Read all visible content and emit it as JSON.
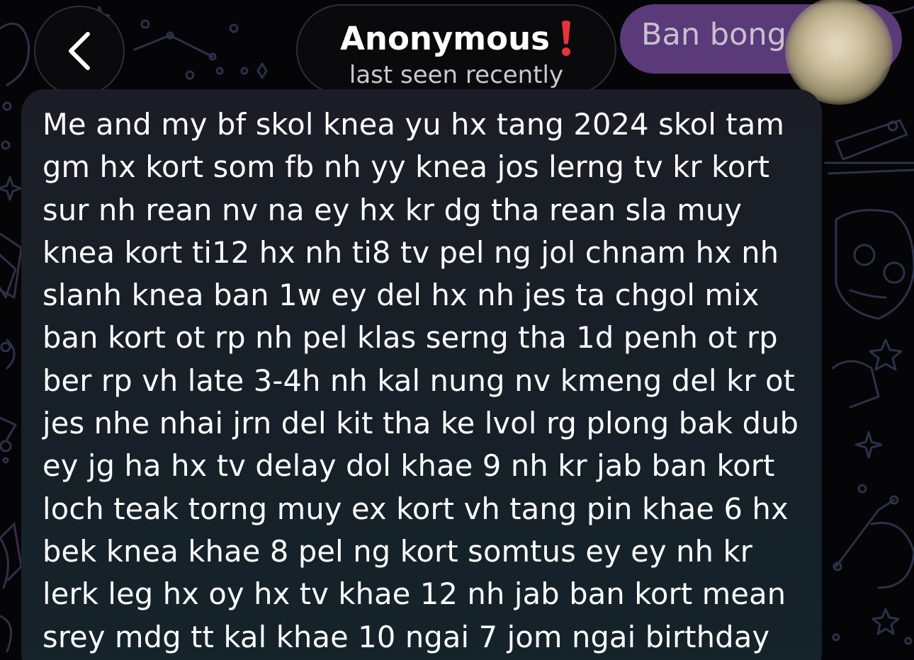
{
  "header": {
    "contact_name": "Anonymous",
    "status": "last seen recently",
    "chat_pill_label": "Ban bong"
  },
  "icons": {
    "back": "chevron-left-icon",
    "warning": "exclamation-icon",
    "avatar": "blurred-profile-photo"
  },
  "colors": {
    "warning": "#e8333a",
    "chat_pill": "#5a3a78",
    "bubble": "#1a1f28"
  },
  "message": {
    "text": "Me and my bf skol knea yu hx tang 2024 skol tam gm hx kort som fb nh yy knea jos lerng tv kr kort sur nh rean nv na ey hx kr dg tha rean sla muy knea kort ti12 hx nh ti8 tv pel ng jol chnam hx nh slanh knea ban 1w ey del hx nh jes ta chgol mix ban kort ot rp nh pel klas serng tha 1d penh ot rp ber rp vh late 3-4h nh kal nung nv kmeng del kr ot jes nhe nhai jrn del kit tha ke lvol rg plong bak dub ey jg ha hx tv delay dol khae 9 nh kr jab ban kort loch teak torng muy ex kort vh tang pin khae 6 hx bek knea khae 8 pel ng kort somtus ey ey nh kr lerk leg hx oy hx tv khae 12 nh jab ban kort mean srey mdg tt kal khae 10 ngai 7 jom ngai birthday"
  }
}
